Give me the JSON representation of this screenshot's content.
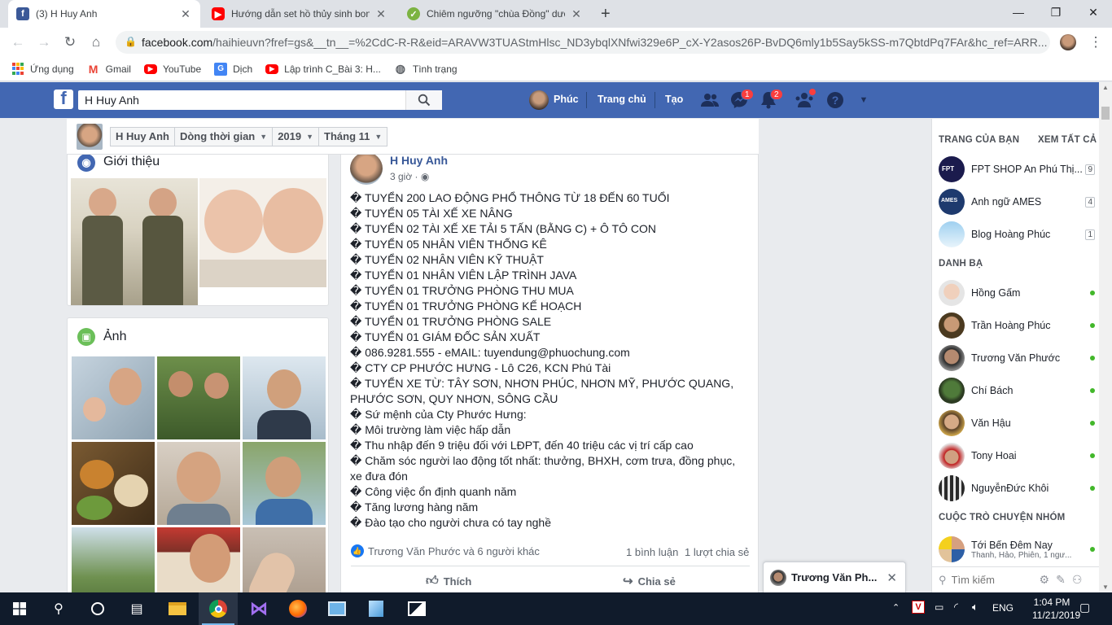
{
  "browser": {
    "tabs": [
      {
        "title": "(3) H Huy Anh",
        "favicon": "facebook-icon",
        "active": true
      },
      {
        "title": "Hướng dẫn set hồ thủy sinh bon",
        "favicon": "youtube-icon",
        "active": false
      },
      {
        "title": "Chiêm ngưỡng \"chùa Đồng\" dướ",
        "favicon": "site-icon",
        "active": false
      }
    ],
    "new_tab": "+",
    "url_host": "facebook.com",
    "url_path": "/haihieuvn?fref=gs&__tn__=%2CdC-R-R&eid=ARAVW3TUAStmHlsc_ND3ybqlXNfwi329e6P_cX-Y2asos26P-BvDQ6mly1b5Say5kSS-m7QbtdPq7FAr&hc_ref=ARR...",
    "bookmarks": [
      "Ứng dụng",
      "Gmail",
      "YouTube",
      "Dịch",
      "Lập trình C_Bài 3: H...",
      "Tình trạng"
    ]
  },
  "fb": {
    "search_value": "H Huy Anh",
    "nav": {
      "profile": "Phúc",
      "home": "Trang chủ",
      "create": "Tạo"
    },
    "badges": {
      "messages": "1",
      "notifications": "2"
    }
  },
  "timeline_header": {
    "name": "H Huy Anh",
    "filter": "Dòng thời gian",
    "year": "2019",
    "month": "Tháng 11"
  },
  "intro": {
    "title": "Giới thiệu"
  },
  "photos": {
    "title": "Ảnh"
  },
  "post": {
    "author": "H Huy Anh",
    "time": "3 giờ ·",
    "more": "···",
    "lines": [
      "� TUYỂN 200 LAO ĐỘNG PHỔ THÔNG TỪ 18 ĐẾN 60 TUỔI",
      "� TUYỂN 05 TÀI XẾ XE NÂNG",
      "� TUYỂN 02 TÀI XẾ XE TẢI 5 TẤN (BẰNG C) + Ô TÔ CON",
      "� TUYỂN 05 NHÂN VIÊN THỐNG KÊ",
      "� TUYỂN 02 NHÂN VIÊN KỸ THUẬT",
      "� TUYỂN 01 NHÂN VIÊN LẬP TRÌNH JAVA",
      "� TUYỂN 01 TRƯỞNG PHÒNG THU MUA",
      "� TUYỂN 01 TRƯỞNG PHÒNG KẾ HOẠCH",
      "� TUYỂN 01 TRƯỞNG PHÒNG SALE",
      "� TUYỂN 01 GIÁM ĐỐC SẢN XUẤT",
      "� 086.9281.555 - eMAIL: tuyendung@phuochung.com",
      "� CTY CP PHƯỚC HƯNG - Lô C26, KCN Phú Tài",
      "� TUYỂN XE TỪ: TÂY SƠN, NHƠN PHÚC, NHƠN MỸ, PHƯỚC QUANG,",
      "PHƯỚC SƠN, QUY NHƠN, SÔNG CẦU",
      "� Sứ mệnh của Cty Phước Hưng:",
      "� Môi trường làm việc hấp dẫn",
      "� Thu nhập đến 9 triệu đối với LĐPT, đến 40 triệu các vị trí cấp cao",
      "� Chăm sóc người lao động tốt nhất: thưởng, BHXH, cơm trưa, đồng phục,",
      "xe đưa đón",
      "� Công việc ổn định quanh năm",
      "� Tăng lương hàng năm",
      "� Đào tạo cho người chưa có tay nghề"
    ],
    "reactions": "Trương Văn Phước và 6 người khác",
    "comments": "1 bình luận",
    "shares": "1 lượt chia sẻ",
    "like_label": "Thích",
    "share_label": "Chia sẻ"
  },
  "sidebar": {
    "pages_title": "TRANG CỦA BẠN",
    "see_all": "XEM TẤT CẢ",
    "pages": [
      {
        "name": "FPT SHOP An Phú Thị...",
        "count": "9"
      },
      {
        "name": "Anh ngữ AMES",
        "count": "4"
      },
      {
        "name": "Blog Hoàng Phúc",
        "count": "1"
      }
    ],
    "contacts_title": "DANH BẠ",
    "contacts": [
      "Hồng Gấm",
      "Trần Hoàng Phúc",
      "Trương Văn Phước",
      "Chí Bách",
      "Văn Hậu",
      "Tony Hoai",
      "NguyễnĐức Khôi"
    ],
    "groups_title": "CUỘC TRÒ CHUYỆN NHÓM",
    "group": {
      "name": "Tới Bến Đêm Nay",
      "members": "Thanh, Hảo, Phiên, 1 ngư..."
    },
    "search_placeholder": "Tìm kiếm"
  },
  "chat": {
    "name": "Trương Văn Ph..."
  },
  "taskbar": {
    "lang": "ENG",
    "time": "1:04 PM",
    "date": "11/21/2019"
  }
}
